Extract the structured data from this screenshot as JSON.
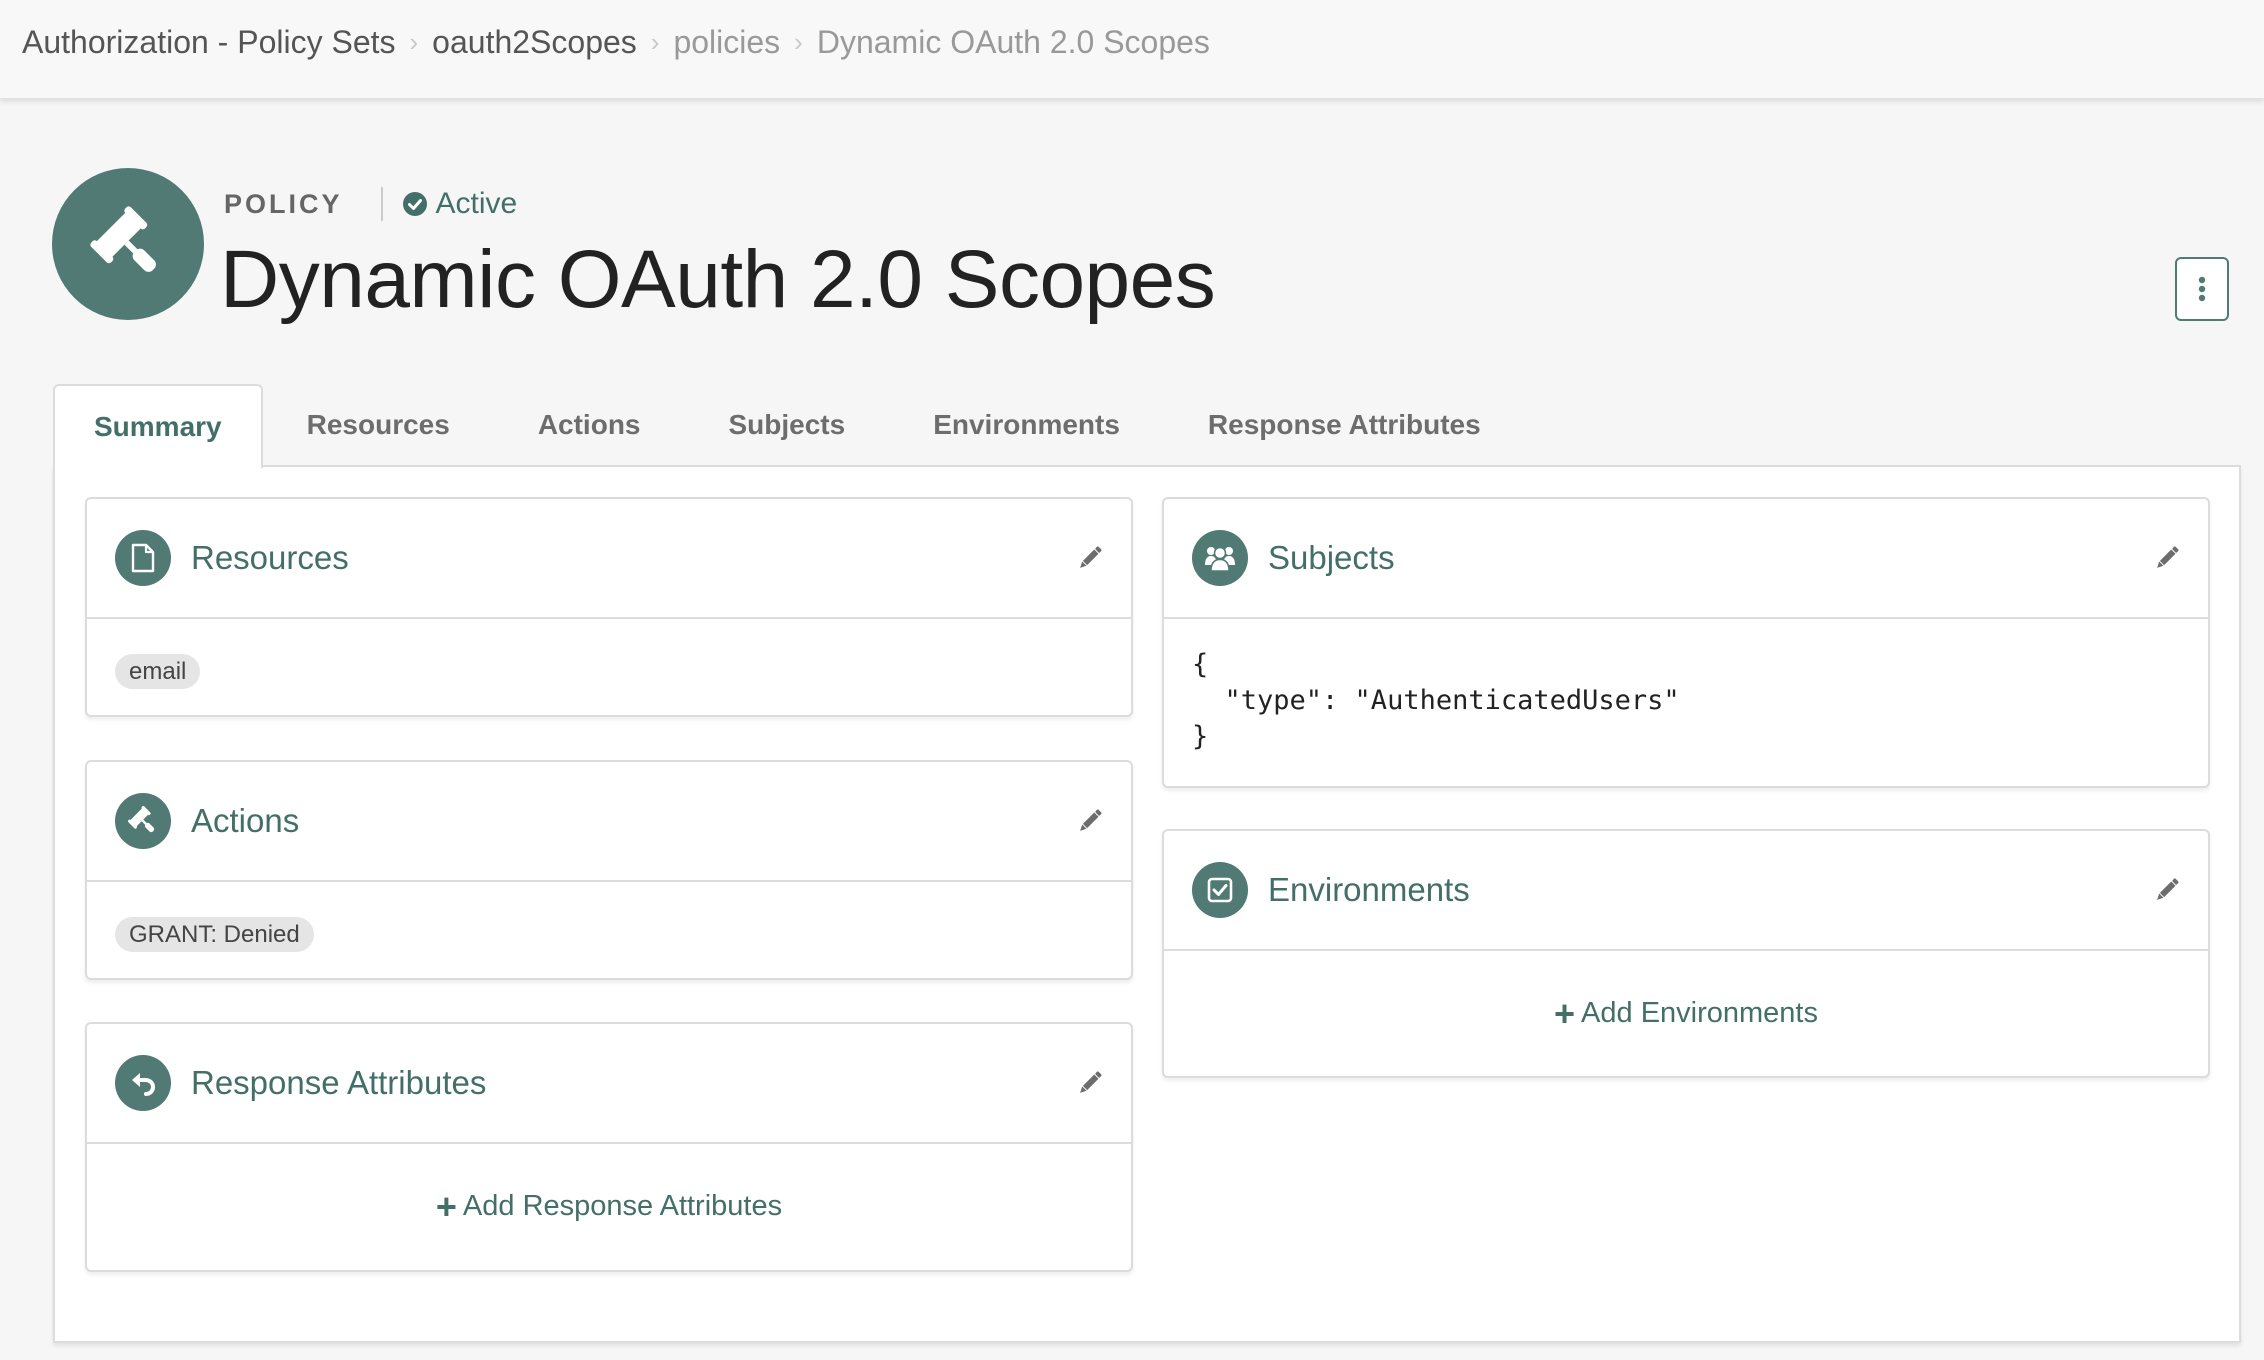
{
  "breadcrumb": [
    {
      "label": "Authorization - Policy Sets",
      "style": "dark"
    },
    {
      "label": "oauth2Scopes",
      "style": "dark"
    },
    {
      "label": "policies",
      "style": "light"
    },
    {
      "label": "Dynamic OAuth 2.0 Scopes",
      "style": "light"
    }
  ],
  "header": {
    "type_label": "POLICY",
    "status": "Active",
    "title": "Dynamic OAuth 2.0 Scopes",
    "avatar_icon": "gavel-icon",
    "menu_icon": "vertical-ellipsis-icon"
  },
  "tabs": [
    {
      "label": "Summary",
      "active": true
    },
    {
      "label": "Resources",
      "active": false
    },
    {
      "label": "Actions",
      "active": false
    },
    {
      "label": "Subjects",
      "active": false
    },
    {
      "label": "Environments",
      "active": false
    },
    {
      "label": "Response Attributes",
      "active": false
    }
  ],
  "cards": {
    "resources": {
      "title": "Resources",
      "icon": "file-icon",
      "items": [
        "email"
      ]
    },
    "actions": {
      "title": "Actions",
      "icon": "gavel-icon",
      "items": [
        "GRANT: Denied"
      ]
    },
    "response_attributes": {
      "title": "Response Attributes",
      "icon": "reply-icon",
      "add_label": "Add Response Attributes"
    },
    "subjects": {
      "title": "Subjects",
      "icon": "users-icon",
      "code": "{\n  \"type\": \"AuthenticatedUsers\"\n}"
    },
    "environments": {
      "title": "Environments",
      "icon": "checkbox-icon",
      "add_label": "Add Environments"
    }
  },
  "colors": {
    "accent": "#517a74",
    "accent_text": "#446f69",
    "background": "#f6f6f6",
    "border": "#dcdcdc",
    "pill_bg": "#e5e5e5"
  }
}
